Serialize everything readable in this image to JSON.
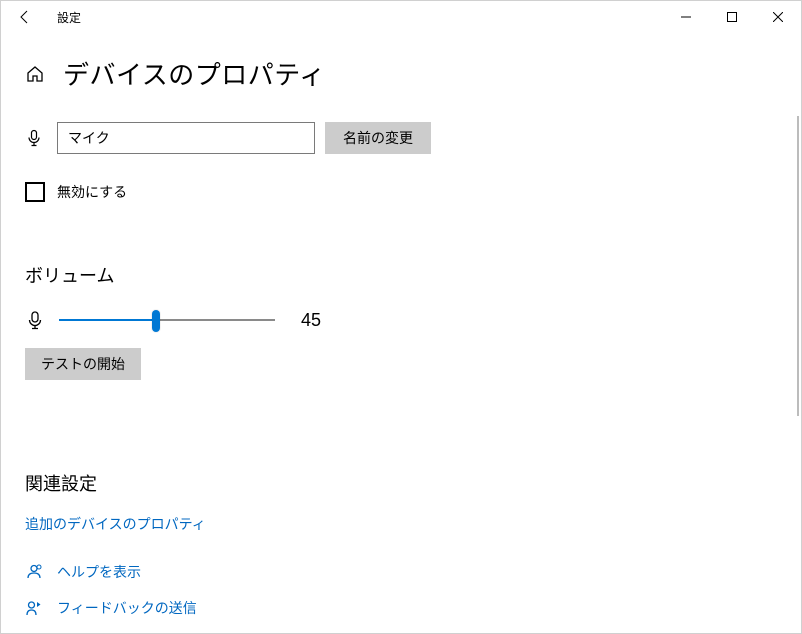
{
  "titlebar": {
    "app_name": "設定"
  },
  "header": {
    "page_title": "デバイスのプロパティ"
  },
  "device": {
    "name_value": "マイク",
    "rename_label": "名前の変更",
    "disable_label": "無効にする",
    "disable_checked": false
  },
  "volume": {
    "heading": "ボリューム",
    "value": 45,
    "min": 0,
    "max": 100,
    "test_label": "テストの開始",
    "slider_percent": 45
  },
  "related": {
    "heading": "関連設定",
    "additional_props_label": "追加のデバイスのプロパティ"
  },
  "footer": {
    "help_label": "ヘルプを表示",
    "feedback_label": "フィードバックの送信"
  }
}
